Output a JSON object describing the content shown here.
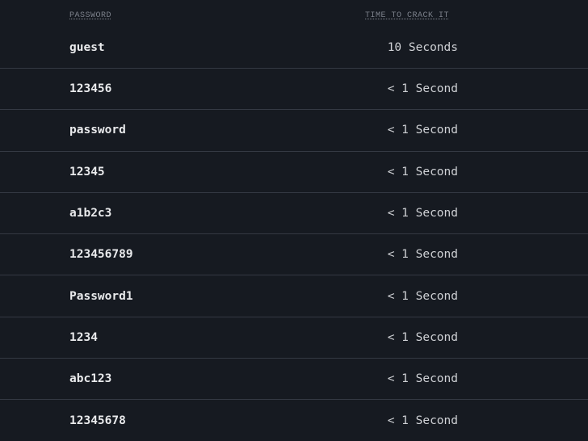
{
  "table": {
    "headers": {
      "password": "PASSWORD",
      "time_to_crack": "TIME TO CRACK IT"
    },
    "rows": [
      {
        "password": "guest",
        "time": "10 Seconds"
      },
      {
        "password": "123456",
        "time": "< 1 Second"
      },
      {
        "password": "password",
        "time": "< 1 Second"
      },
      {
        "password": "12345",
        "time": "< 1 Second"
      },
      {
        "password": "a1b2c3",
        "time": "< 1 Second"
      },
      {
        "password": "123456789",
        "time": "< 1 Second"
      },
      {
        "password": "Password1",
        "time": "< 1 Second"
      },
      {
        "password": "1234",
        "time": "< 1 Second"
      },
      {
        "password": "abc123",
        "time": "< 1 Second"
      },
      {
        "password": "12345678",
        "time": "< 1 Second"
      }
    ]
  }
}
